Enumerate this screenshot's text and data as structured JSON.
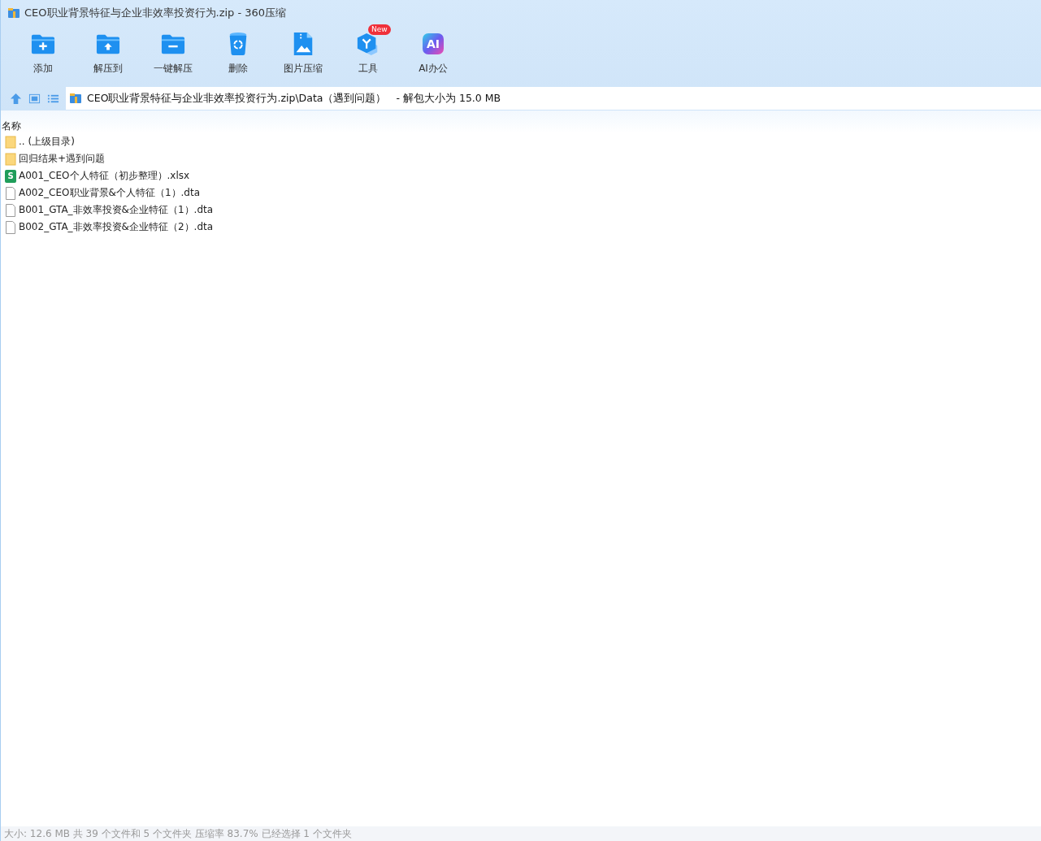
{
  "window": {
    "title": "CEO职业背景特征与企业非效率投资行为.zip - 360压缩"
  },
  "toolbar": [
    {
      "kind": "add",
      "label": "添加"
    },
    {
      "kind": "extract-to",
      "label": "解压到"
    },
    {
      "kind": "one-click",
      "label": "一键解压"
    },
    {
      "kind": "delete",
      "label": "删除"
    },
    {
      "kind": "image",
      "label": "图片压缩"
    },
    {
      "kind": "tools",
      "label": "工具",
      "badge": "New"
    },
    {
      "kind": "ai",
      "label": "AI办公",
      "icon_text": "AI"
    }
  ],
  "address_bar": {
    "path": "CEO职业背景特征与企业非效率投资行为.zip\\Data（遇到问题）",
    "size_note": "- 解包大小为 15.0 MB"
  },
  "table": {
    "columns": [
      "名称"
    ],
    "rows": [
      {
        "kind": "folder",
        "name": ".. (上级目录)"
      },
      {
        "kind": "folder",
        "name": "回归结果+遇到问题"
      },
      {
        "kind": "xlsx",
        "name": "A001_CEO个人特征（初步整理）.xlsx",
        "icon_text": "S"
      },
      {
        "kind": "file",
        "name": "A002_CEO职业背景&个人特征（1）.dta"
      },
      {
        "kind": "file",
        "name": "B001_GTA_非效率投资&企业特征（1）.dta"
      },
      {
        "kind": "file",
        "name": "B002_GTA_非效率投资&企业特征（2）.dta"
      }
    ]
  },
  "status_bar": "大小: 12.6 MB 共 39 个文件和 5 个文件夹 压缩率 83.7% 已经选择 1 个文件夹"
}
